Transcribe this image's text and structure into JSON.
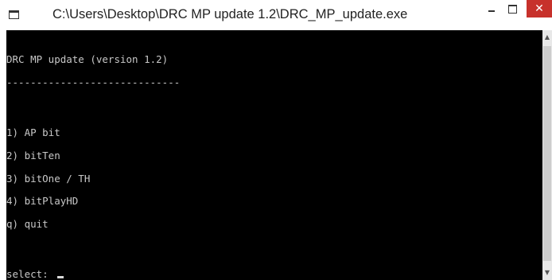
{
  "window": {
    "title": "C:\\Users\\Desktop\\DRC MP update 1.2\\DRC_MP_update.exe",
    "minimize_glyph": "",
    "close_glyph": "✕"
  },
  "console": {
    "header": "DRC MP update (version 1.2)",
    "separator": "-----------------------------",
    "menu": [
      "1) AP bit",
      "2) bitTen",
      "3) bitOne / TH",
      "4) bitPlayHD",
      "q) quit"
    ],
    "prompt": "select: "
  },
  "colors": {
    "console_bg": "#000000",
    "console_text": "#c8c8c8",
    "close_button": "#c7312b"
  },
  "icons": {
    "app": "console-window-icon",
    "minimize": "minimize-icon",
    "maximize": "maximize-icon",
    "close": "close-icon",
    "scroll_up": "scroll-up-arrow-icon",
    "scroll_down": "scroll-down-arrow-icon"
  }
}
